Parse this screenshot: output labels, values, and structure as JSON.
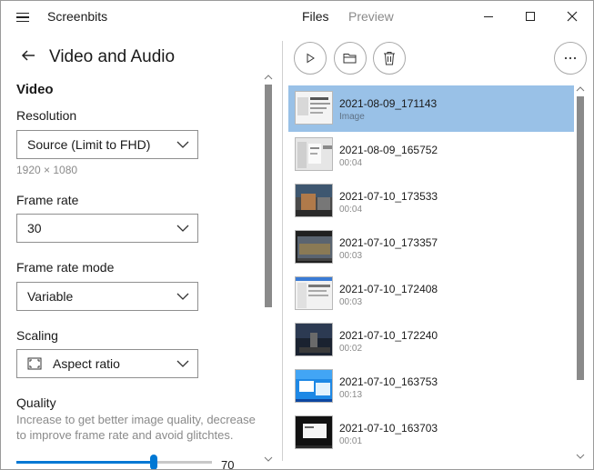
{
  "app": {
    "title": "Screenbits"
  },
  "nav_tabs": [
    {
      "label": "Files",
      "active": true
    },
    {
      "label": "Preview",
      "active": false
    }
  ],
  "settings": {
    "title": "Video and Audio",
    "section": "Video",
    "resolution": {
      "label": "Resolution",
      "value": "Source (Limit to FHD)",
      "detail": "1920 × 1080"
    },
    "frame_rate": {
      "label": "Frame rate",
      "value": "30"
    },
    "frame_rate_mode": {
      "label": "Frame rate mode",
      "value": "Variable"
    },
    "scaling": {
      "label": "Scaling",
      "value": "Aspect ratio",
      "icon": "aspect-ratio-icon"
    },
    "quality": {
      "label": "Quality",
      "description": "Increase to get better image quality, decrease to improve frame rate and avoid glitchtes.",
      "value": "70",
      "slider_fraction": 0.7
    }
  },
  "toolbar": {
    "buttons": [
      {
        "name": "play",
        "icon": "play-icon"
      },
      {
        "name": "open-folder",
        "icon": "folder-icon"
      },
      {
        "name": "delete",
        "icon": "trash-icon"
      },
      {
        "name": "more",
        "icon": "more-icon"
      }
    ]
  },
  "files": [
    {
      "name": "2021-08-09_171143",
      "meta": "Image",
      "selected": true,
      "thumb": "light"
    },
    {
      "name": "2021-08-09_165752",
      "meta": "00:04",
      "selected": false,
      "thumb": "gray"
    },
    {
      "name": "2021-07-10_173533",
      "meta": "00:04",
      "selected": false,
      "thumb": "photo"
    },
    {
      "name": "2021-07-10_173357",
      "meta": "00:03",
      "selected": false,
      "thumb": "dark"
    },
    {
      "name": "2021-07-10_172408",
      "meta": "00:03",
      "selected": false,
      "thumb": "light"
    },
    {
      "name": "2021-07-10_172240",
      "meta": "00:02",
      "selected": false,
      "thumb": "night"
    },
    {
      "name": "2021-07-10_163753",
      "meta": "00:13",
      "selected": false,
      "thumb": "blue"
    },
    {
      "name": "2021-07-10_163703",
      "meta": "00:01",
      "selected": false,
      "thumb": "darkwin"
    }
  ],
  "colors": {
    "accent": "#0078d4",
    "selection": "#99c1e7",
    "muted_text": "#8a8a8a"
  }
}
